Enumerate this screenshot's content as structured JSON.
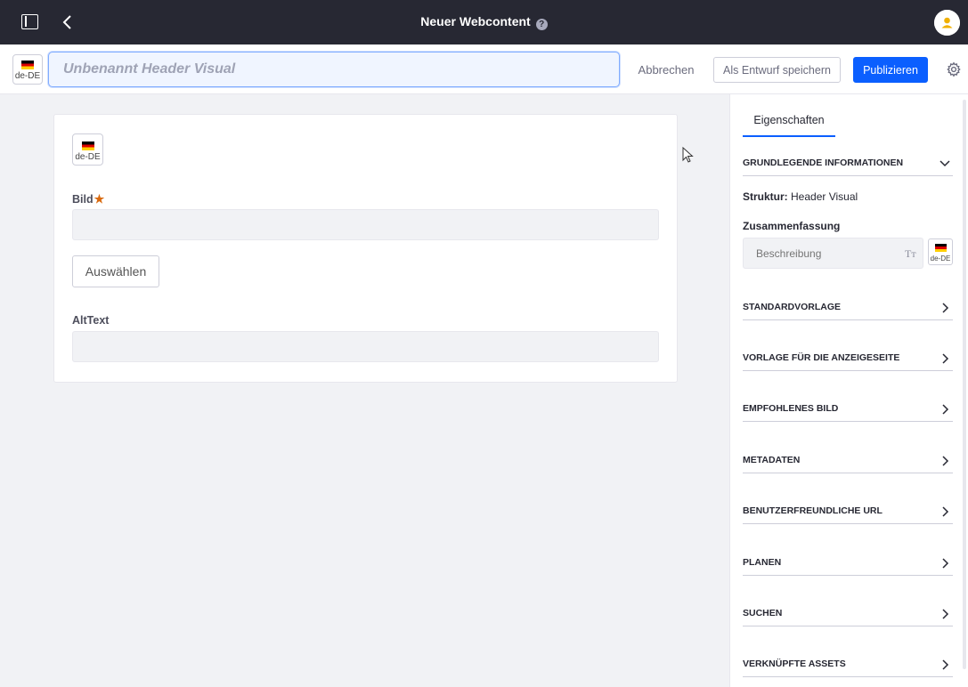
{
  "topbar": {
    "title": "Neuer Webcontent",
    "help_icon_text": "?"
  },
  "titlerow": {
    "language": "de-DE",
    "title_placeholder": "Unbenannt Header Visual",
    "cancel_label": "Abbrechen",
    "draft_label": "Als Entwurf speichern",
    "publish_label": "Publizieren"
  },
  "form": {
    "language": "de-DE",
    "image_label": "Bild",
    "required_marker": "★",
    "select_label": "Auswählen",
    "alt_label": "AltText"
  },
  "sidebar": {
    "tab_label": "Eigenschaften",
    "basic_info": "GRUNDLEGENDE INFORMATIONEN",
    "structure_label": "Struktur:",
    "structure_value": "Header Visual",
    "summary_label": "Zusammenfassung",
    "description_placeholder": "Beschreibung",
    "text_format_icon": "Tт",
    "language": "de-DE",
    "sections": [
      "STANDARDVORLAGE",
      "VORLAGE FÜR DIE ANZEIGESEITE",
      "EMPFOHLENES BILD",
      "METADATEN",
      "BENUTZERFREUNDLICHE URL",
      "PLANEN",
      "SUCHEN",
      "VERKNÜPFTE ASSETS"
    ]
  },
  "colors": {
    "topbar_bg": "#272833",
    "primary": "#0b5fff",
    "required": "#d96a0f"
  }
}
